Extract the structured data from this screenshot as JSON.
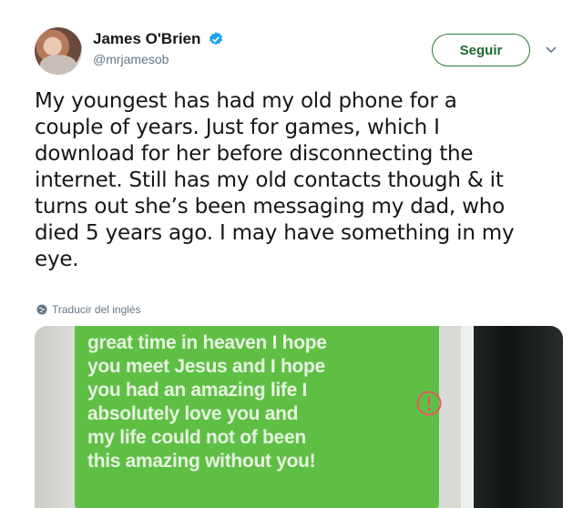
{
  "tweet": {
    "author": {
      "display_name": "James O'Brien",
      "handle": "@mrjamesob",
      "verified": true
    },
    "follow_label": "Seguir",
    "text": "My youngest has had my old phone for a\ncouple of years. Just for games, which I\ndownload for her before disconnecting the\ninternet. Still has my old contacts though & it\nturns out she’s been messaging my dad, who\ndied 5 years ago. I may have something in my\neye.",
    "translate_label": "Traducir del inglés"
  },
  "media": {
    "message_text": "great time in heaven I hope\nyou meet Jesus and I hope\nyou had an amazing life I\nabsolutely love you and\nmy life could not of been\nthis amazing without you!",
    "bubble_color": "#5fbf45",
    "error_color": "#e05a5a"
  },
  "colors": {
    "accent": "#2d7a3a",
    "verified": "#1da1f2",
    "secondary_text": "#657786"
  },
  "icons": [
    "verified-icon",
    "chevron-down-icon",
    "globe-icon",
    "error-icon"
  ]
}
